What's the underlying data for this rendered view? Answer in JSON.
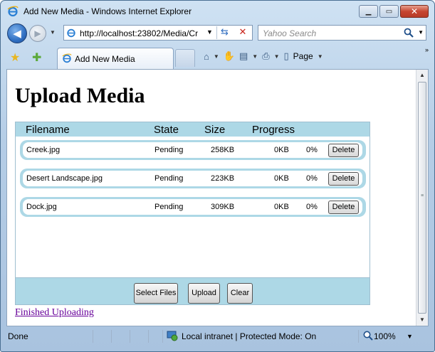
{
  "window": {
    "title": "Add New Media - Windows Internet Explorer"
  },
  "address_bar": {
    "url": "http://localhost:23802/Media/Cr"
  },
  "search_box": {
    "placeholder": "Yahoo Search"
  },
  "tab": {
    "label": "Add New Media"
  },
  "command_bar": {
    "page_label": "Page"
  },
  "page": {
    "heading": "Upload Media",
    "columns": {
      "filename": "Filename",
      "state": "State",
      "size": "Size",
      "progress": "Progress"
    },
    "files": [
      {
        "filename": "Creek.jpg",
        "state": "Pending",
        "size": "258KB",
        "uploaded": "0KB",
        "percent": "0%",
        "delete_label": "Delete"
      },
      {
        "filename": "Desert Landscape.jpg",
        "state": "Pending",
        "size": "223KB",
        "uploaded": "0KB",
        "percent": "0%",
        "delete_label": "Delete"
      },
      {
        "filename": "Dock.jpg",
        "state": "Pending",
        "size": "309KB",
        "uploaded": "0KB",
        "percent": "0%",
        "delete_label": "Delete"
      }
    ],
    "buttons": {
      "select_files": "Select Files",
      "upload": "Upload",
      "clear": "Clear"
    },
    "finished_link": "Finished Uploading"
  },
  "status_bar": {
    "status": "Done",
    "zone": "Local intranet | Protected Mode: On",
    "zoom": "100%"
  },
  "colors": {
    "uploader_accent": "#add8e6",
    "visited_link": "#660099"
  }
}
